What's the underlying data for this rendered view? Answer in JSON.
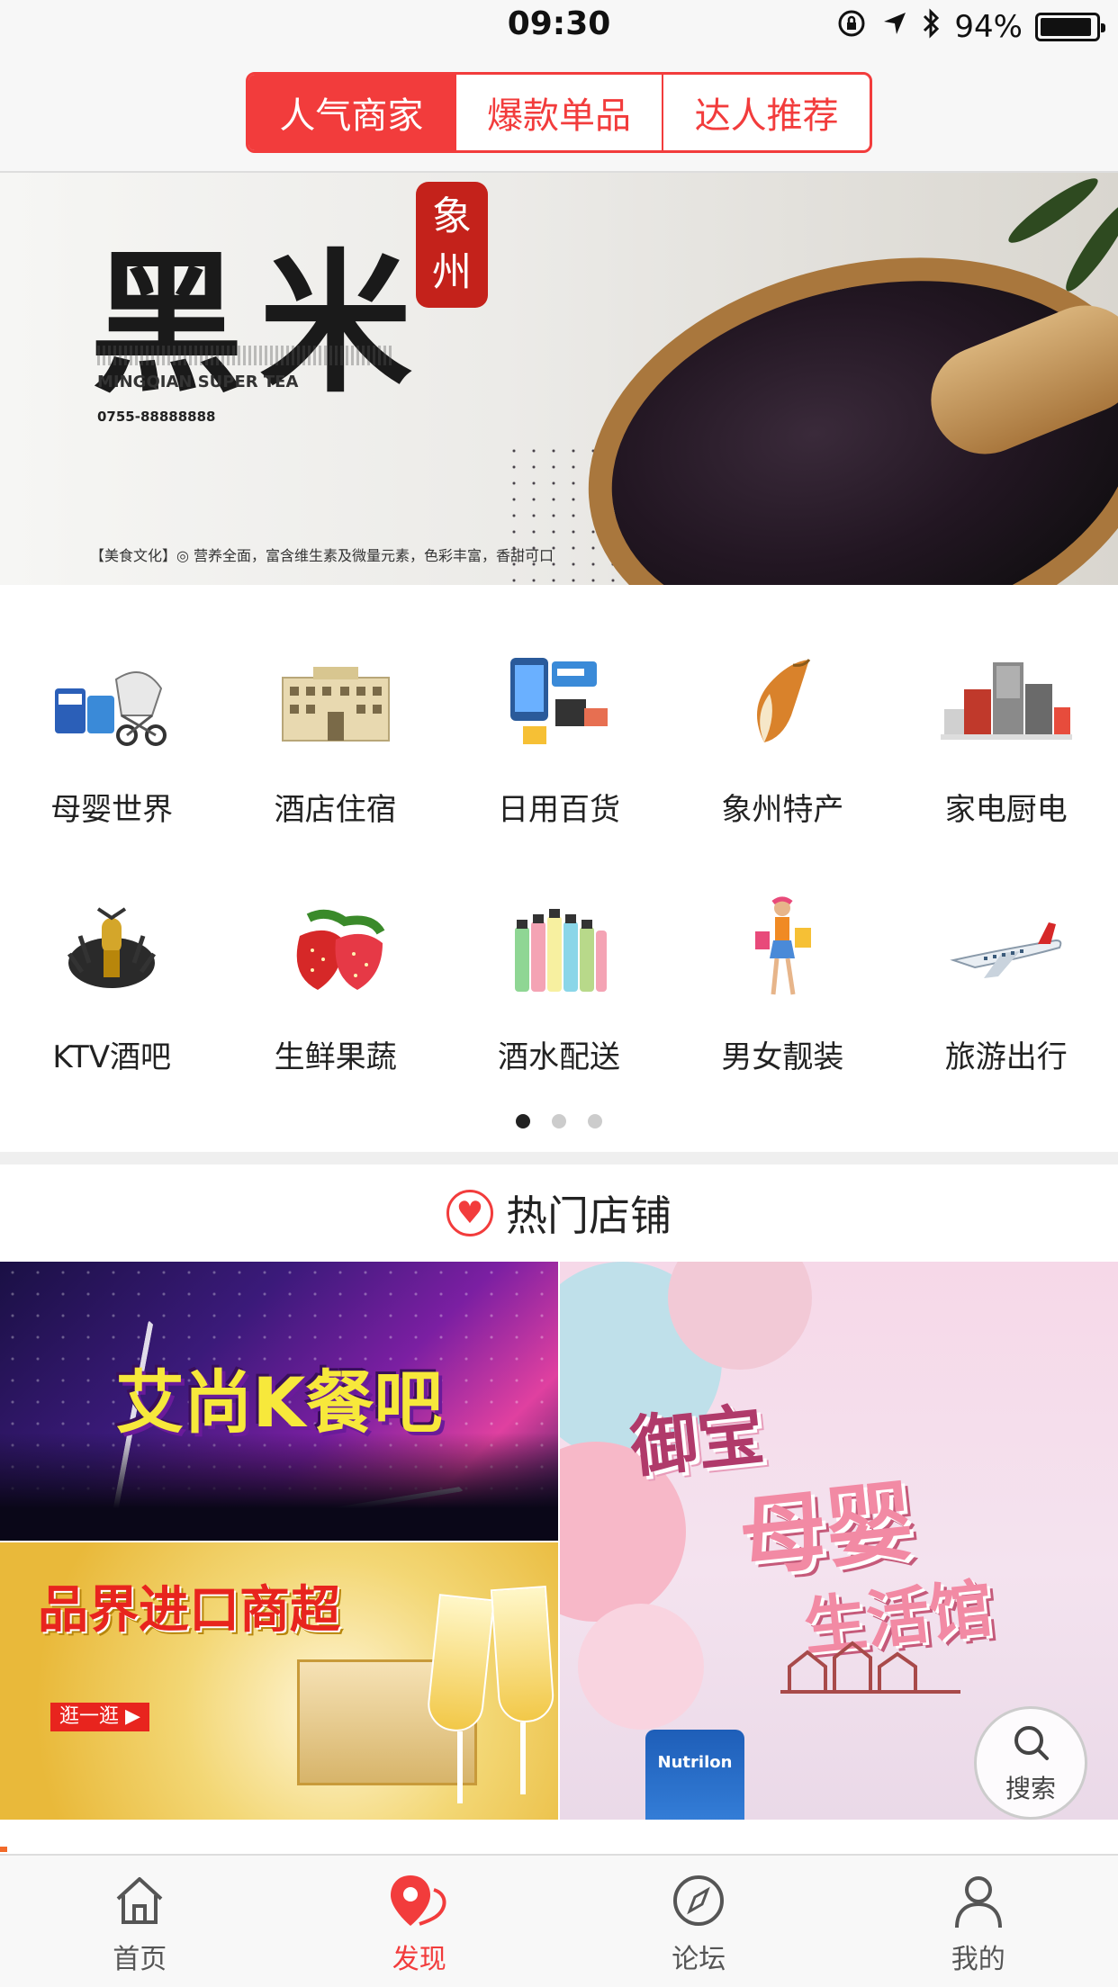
{
  "status_bar": {
    "time": "09:30",
    "battery_percent": "94%",
    "battery_level": 0.94,
    "icons": [
      "orientation-lock-icon",
      "location-arrow-icon",
      "bluetooth-icon",
      "battery-icon"
    ]
  },
  "header": {
    "segments": [
      {
        "label": "人气商家",
        "active": true
      },
      {
        "label": "爆款单品",
        "active": false
      },
      {
        "label": "达人推荐",
        "active": false
      }
    ],
    "accent_color": "#f23c3c"
  },
  "banner": {
    "title": "黑米",
    "seal": "象州",
    "subtitle": "MINGQIAN SUPER TEA",
    "phone": "0755-88888888",
    "footer": "【美食文化】◎ 营养全面，富含维生素及微量元素，色彩丰富，香甜可口"
  },
  "categories": {
    "items": [
      {
        "label": "母婴世界",
        "icon": "baby-stroller-icon"
      },
      {
        "label": "酒店住宿",
        "icon": "hotel-icon"
      },
      {
        "label": "日用百货",
        "icon": "daily-goods-icon"
      },
      {
        "label": "象州特产",
        "icon": "rice-icon"
      },
      {
        "label": "家电厨电",
        "icon": "appliances-icon"
      },
      {
        "label": "KTV酒吧",
        "icon": "microphone-icon"
      },
      {
        "label": "生鲜果蔬",
        "icon": "strawberry-icon"
      },
      {
        "label": "酒水配送",
        "icon": "bottles-icon"
      },
      {
        "label": "男女靓装",
        "icon": "shopping-girl-icon"
      },
      {
        "label": "旅游出行",
        "icon": "airplane-icon"
      }
    ],
    "page_count": 3,
    "current_page": 1
  },
  "hot_shops": {
    "title": "热门店铺",
    "shops": {
      "ktv": {
        "name": "艾尚K餐吧"
      },
      "import": {
        "name": "品界进口商超",
        "button": "逛一逛 ▶"
      },
      "baby": {
        "brand": "御宝",
        "name_line1": "母婴",
        "name_line2": "生活馆",
        "product": "Nutrilon"
      }
    }
  },
  "search_button": {
    "label": "搜索"
  },
  "tabbar": {
    "tabs": [
      {
        "label": "首页",
        "icon": "home-icon",
        "active": false
      },
      {
        "label": "发现",
        "icon": "location-pin-icon",
        "active": true
      },
      {
        "label": "论坛",
        "icon": "compass-icon",
        "active": false
      },
      {
        "label": "我的",
        "icon": "person-icon",
        "active": false
      }
    ]
  }
}
